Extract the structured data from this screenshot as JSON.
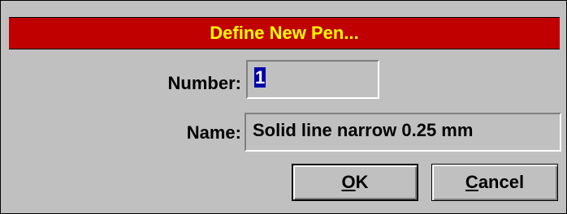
{
  "dialog": {
    "title": "Define New Pen..."
  },
  "number": {
    "label": "Number:",
    "value": "1"
  },
  "name": {
    "label": "Name:",
    "value": "Solid line narrow 0.25 mm"
  },
  "buttons": {
    "ok": {
      "accel": "O",
      "rest": "K"
    },
    "cancel": {
      "accel": "C",
      "rest": "ancel"
    }
  },
  "colors": {
    "title_bar": "#c00000",
    "title_text": "#ffff00",
    "background": "#c0c0c0",
    "selection": "#0000a8"
  }
}
